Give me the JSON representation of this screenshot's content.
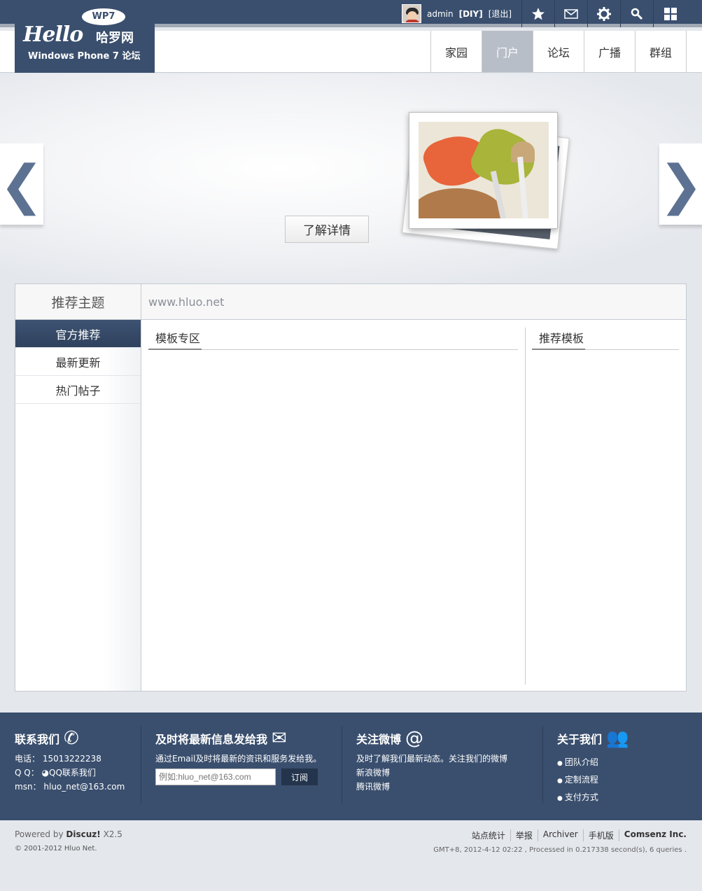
{
  "topbar": {
    "username": "admin",
    "diy": "[DIY]",
    "logout": "[退出]",
    "icons": [
      "star-icon",
      "mail-icon",
      "gear-icon",
      "search-icon",
      "grid-icon"
    ]
  },
  "logo": {
    "badge": "WP7",
    "hello": "Hello",
    "cn": "哈罗网",
    "subtitle": "Windows Phone 7 论坛"
  },
  "nav": {
    "items": [
      {
        "label": "家园"
      },
      {
        "label": "门户"
      },
      {
        "label": "论坛"
      },
      {
        "label": "广播"
      },
      {
        "label": "群组"
      }
    ],
    "active_index": 1
  },
  "banner": {
    "prev_glyph": "❮",
    "next_glyph": "❯",
    "detail_button": "了解详情"
  },
  "panel": {
    "side_title": "推荐主题",
    "tabs": [
      "官方推荐",
      "最新更新",
      "热门帖子"
    ],
    "active_tab": 0,
    "url": "www.hluo.net",
    "section_left": "模板专区",
    "section_right": "推荐模板"
  },
  "footer": {
    "contact": {
      "title": "联系我们",
      "phone_label": "电话：",
      "phone": "15013222238",
      "qq_label": "Q Q：",
      "qq": "QQ联系我们",
      "msn_label": "msn：",
      "msn": "hluo_net@163.com"
    },
    "subscribe": {
      "title": "及时将最新信息发给我",
      "desc": "通过Email及时将最新的资讯和服务发给我。",
      "placeholder": "例如:hluo_net@163.com",
      "button": "订阅"
    },
    "weibo": {
      "title": "关注微博",
      "desc": "及时了解我们最新动态。关注我们的微博",
      "links": [
        "新浪微博",
        "腾讯微博"
      ]
    },
    "about": {
      "title": "关于我们",
      "links": [
        "团队介绍",
        "定制流程",
        "支付方式"
      ]
    }
  },
  "bottom": {
    "powered_prefix": "Powered by",
    "powered_brand": "Discuz!",
    "powered_version": "X2.5",
    "copyright": "© 2001-2012 Hluo Net.",
    "links": [
      "站点统计",
      "举报",
      "Archiver",
      "手机版",
      "Comsenz Inc."
    ],
    "gmt": "GMT+8, 2012-4-12 02:22 , Processed in 0.217338 second(s), 6 queries ."
  },
  "colors": {
    "header": "#3a4f6e",
    "nav_active": "#b8bec8",
    "page_bg": "#e4e7ec"
  }
}
